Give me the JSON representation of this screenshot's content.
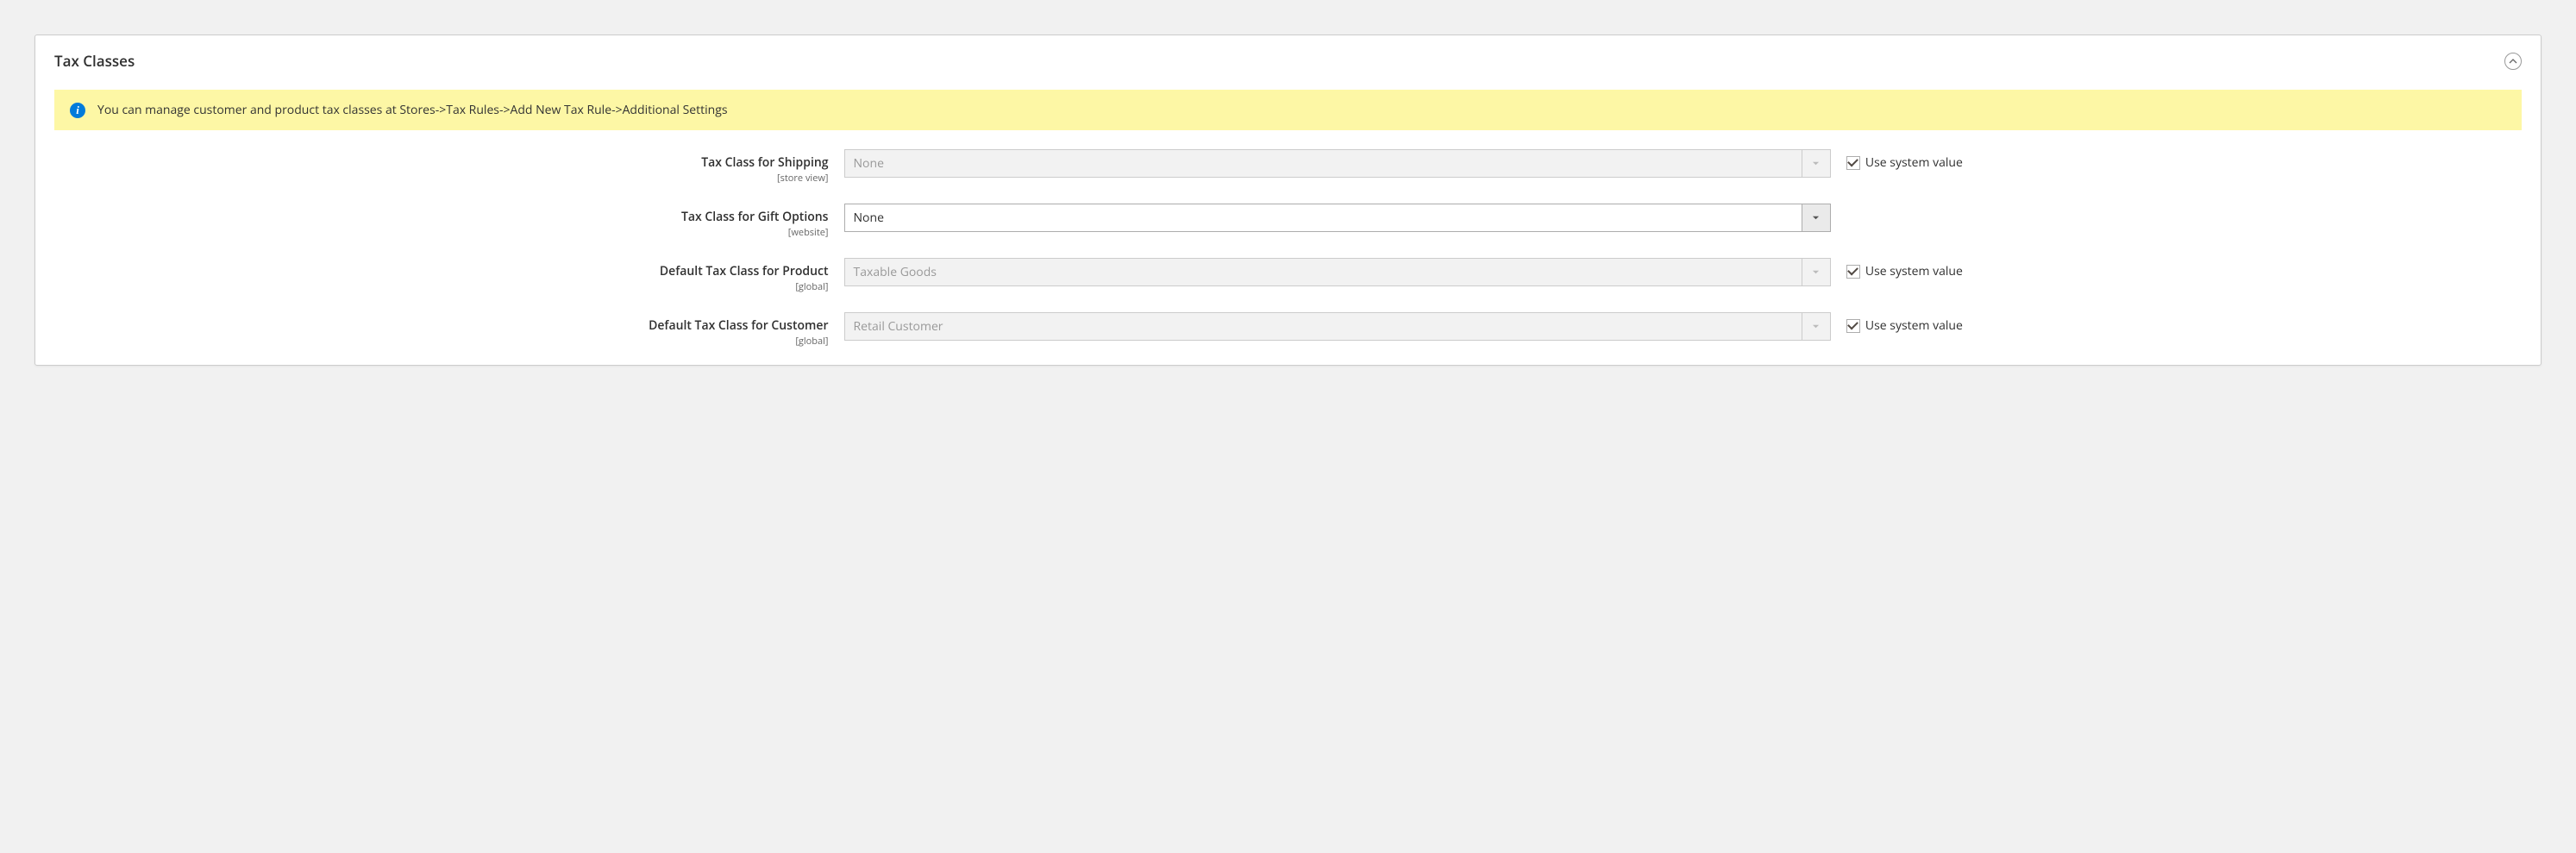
{
  "panel": {
    "title": "Tax Classes"
  },
  "notice": {
    "text": "You can manage customer and product tax classes at Stores->Tax Rules->Add New Tax Rule->Additional Settings"
  },
  "use_system_value_label": "Use system value",
  "fields": [
    {
      "label": "Tax Class for Shipping",
      "scope": "[store view]",
      "value": "None",
      "disabled": true,
      "use_system": true
    },
    {
      "label": "Tax Class for Gift Options",
      "scope": "[website]",
      "value": "None",
      "disabled": false,
      "use_system": false
    },
    {
      "label": "Default Tax Class for Product",
      "scope": "[global]",
      "value": "Taxable Goods",
      "disabled": true,
      "use_system": true
    },
    {
      "label": "Default Tax Class for Customer",
      "scope": "[global]",
      "value": "Retail Customer",
      "disabled": true,
      "use_system": true
    }
  ]
}
